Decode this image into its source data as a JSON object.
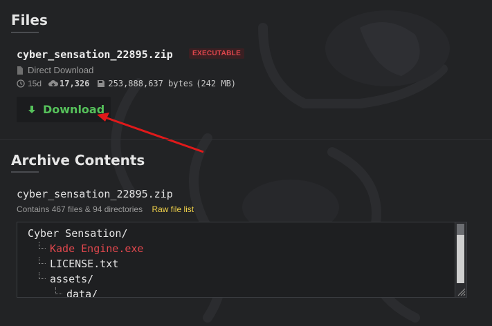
{
  "files": {
    "title": "Files",
    "filename": "cyber_sensation_22895.zip",
    "badge": "EXECUTABLE",
    "download_type": "Direct Download",
    "age": "15d",
    "downloads": "17,326",
    "size_bytes": "253,888,637 bytes",
    "size_human": "(242 MB)",
    "download_label": "Download"
  },
  "archive": {
    "title": "Archive Contents",
    "filename": "cyber_sensation_22895.zip",
    "summary": "Contains 467 files & 94 directories",
    "raw_link": "Raw file list",
    "tree": [
      {
        "name": "Cyber Sensation/",
        "depth": 0,
        "executable": false
      },
      {
        "name": "Kade Engine.exe",
        "depth": 1,
        "executable": true
      },
      {
        "name": "LICENSE.txt",
        "depth": 1,
        "executable": false
      },
      {
        "name": "assets/",
        "depth": 1,
        "executable": false
      },
      {
        "name": "data/",
        "depth": 2,
        "executable": false
      }
    ]
  },
  "colors": {
    "background": "#222325",
    "accent_green": "#56c25b",
    "danger_red": "#e0474d",
    "link_yellow": "#f0d14a",
    "annotation_arrow": "#e0191a"
  },
  "icons": {
    "file": "file-icon",
    "clock": "clock-icon",
    "cloud_download": "cloud-download-icon",
    "disk": "floppy-disk-icon",
    "download": "arrow-down-icon"
  }
}
